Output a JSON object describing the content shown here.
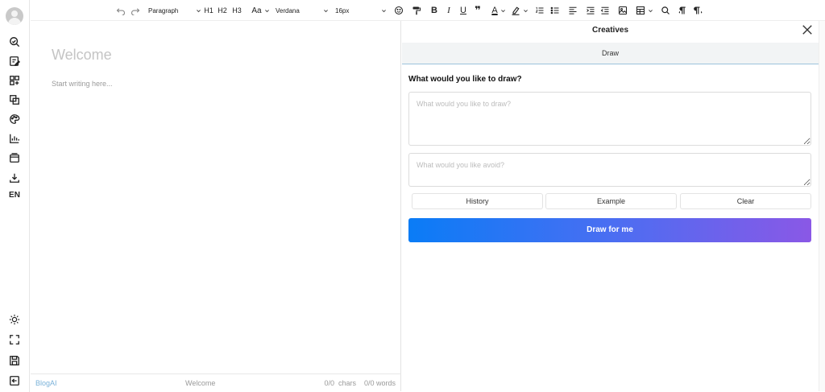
{
  "sidebar": {
    "top_icons": [
      "search-edit-icon",
      "note-edit-icon",
      "add-grid-icon",
      "copy-icon",
      "palette-icon",
      "chart-icon",
      "window-icon",
      "download-icon"
    ],
    "language": "EN",
    "bottom_icons": [
      "sun-icon",
      "fullscreen-icon",
      "save-icon",
      "logout-icon"
    ]
  },
  "toolbar": {
    "block_format": "Paragraph",
    "h1": "H1",
    "h2": "H2",
    "h3": "H3",
    "case": "Aa",
    "font_family": "Verdana",
    "font_size": "16px",
    "bold": "B",
    "italic": "I",
    "underline": "U",
    "quote": "❞",
    "font_color": "A"
  },
  "editor": {
    "title": "Welcome",
    "placeholder": "Start writing here..."
  },
  "statusbar": {
    "brand": "BlogAI",
    "doc_title": "Welcome",
    "counts": "0/0  chars    0/0 words"
  },
  "panel": {
    "title": "Creatives",
    "tab_draw": "Draw",
    "question": "What would you like to draw?",
    "draw_placeholder": "What would you like to draw?",
    "avoid_placeholder": "What would you like avoid?",
    "history_label": "History",
    "example_label": "Example",
    "clear_label": "Clear",
    "draw_button": "Draw for me"
  },
  "colors": {
    "accent_start": "#0a7cf6",
    "accent_end": "#8a58e6",
    "brand": "#7ab2d9"
  }
}
